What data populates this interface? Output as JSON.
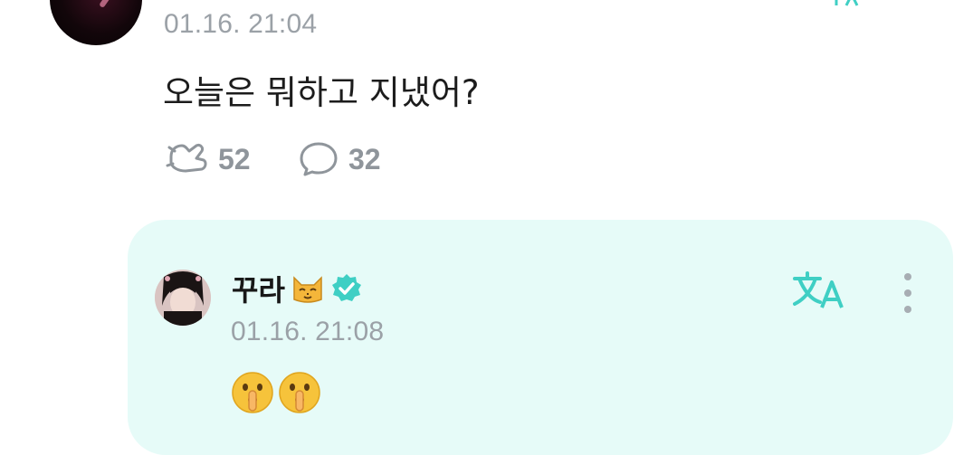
{
  "post": {
    "timestamp": "01.16. 21:04",
    "text": "오늘은 뭐하고 지냈어?",
    "likes": "52",
    "comments": "32"
  },
  "reply": {
    "name": "꾸라",
    "name_emoji": "cat-face-icon",
    "verified": true,
    "timestamp": "01.16. 21:08",
    "emojis": [
      "shushing-face-icon",
      "shushing-face-icon"
    ]
  },
  "colors": {
    "accent": "#3fcfc4",
    "reply_bg": "#e6fbf8",
    "muted": "#9ba1a7"
  }
}
